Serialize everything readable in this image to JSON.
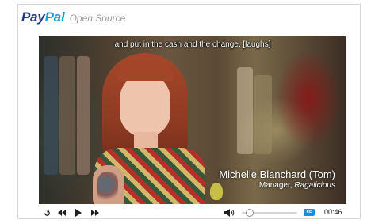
{
  "brand": {
    "logo_part1": "Pay",
    "logo_part2": "Pal",
    "subtitle": "Open Source",
    "colors": {
      "pay": "#253b80",
      "pal": "#179bd7"
    }
  },
  "video": {
    "caption": "and put in the cash and the change. [laughs]",
    "lower_third": {
      "name": "Michelle Blanchard (Tom)",
      "role_prefix": "Manager, ",
      "company": "Ragalicious"
    }
  },
  "controls": {
    "repeat_icon": "repeat-icon",
    "rewind_icon": "rewind-icon",
    "play_icon": "play-icon",
    "fast_forward_icon": "fast-forward-icon",
    "volume_icon": "volume-icon",
    "cc_label": "cc",
    "cc_color": "#1b8ee0",
    "time": "00:46"
  }
}
